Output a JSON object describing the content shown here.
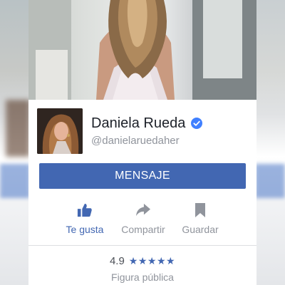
{
  "profile": {
    "name": "Daniela Rueda",
    "handle": "@danielaruedaher"
  },
  "buttons": {
    "message_label": "MENSAJE"
  },
  "actions": [
    {
      "label": "Te gusta",
      "icon": "thumbs-up-icon",
      "active": true
    },
    {
      "label": "Compartir",
      "icon": "share-icon",
      "active": false
    },
    {
      "label": "Guardar",
      "icon": "bookmark-icon",
      "active": false
    }
  ],
  "rating": {
    "value": "4.9",
    "stars": "★★★★★"
  },
  "category": "Figura pública",
  "colors": {
    "brand_blue": "#4267b2",
    "verified_blue": "#4080ff",
    "muted_text": "#90949c"
  }
}
